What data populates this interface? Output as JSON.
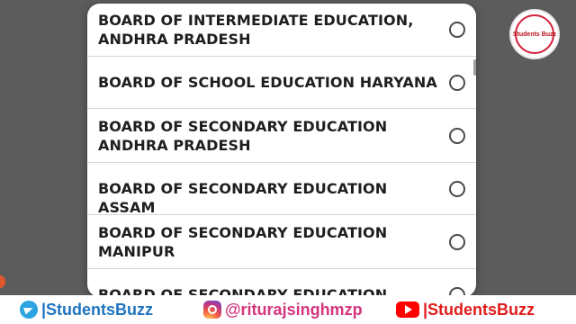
{
  "dialog": {
    "options": [
      {
        "label": "BOARD OF INTERMEDIATE EDUCATION, ANDHRA PRADESH",
        "selected": false
      },
      {
        "label": "BOARD OF SCHOOL EDUCATION HARYANA",
        "selected": false
      },
      {
        "label": "BOARD OF SECONDARY EDUCATION ANDHRA PRADESH",
        "selected": false
      },
      {
        "label": "BOARD OF SECONDARY EDUCATION ASSAM",
        "selected": false
      },
      {
        "label": "BOARD OF SECONDARY EDUCATION MANIPUR",
        "selected": false
      },
      {
        "label": "BOARD OF SECONDARY EDUCATION ODISHA",
        "selected": false
      }
    ]
  },
  "watermark": {
    "logo_text": "Students Buzz"
  },
  "footer": {
    "telegram": "|StudentsBuzz",
    "instagram": "@riturajsinghmzp",
    "youtube": "|StudentsBuzz"
  },
  "colors": {
    "telegram": "#2ba4e0",
    "instagram": "#d4357d",
    "youtube": "#e01b1b",
    "logo": "#b5121b"
  }
}
